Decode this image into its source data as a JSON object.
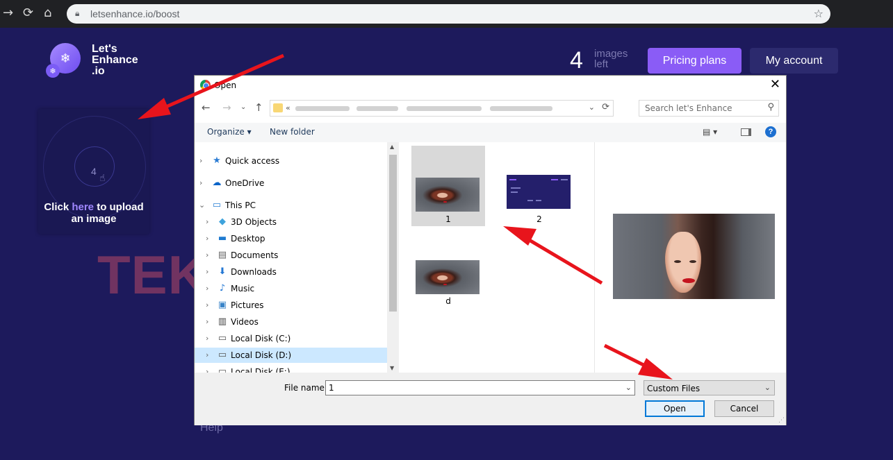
{
  "browser": {
    "url": "letsenhance.io/boost"
  },
  "app": {
    "logo": [
      "Let's",
      "Enhance",
      ".io"
    ],
    "credits_count": "4",
    "credits_label": [
      "images",
      "left"
    ],
    "pricing_button": "Pricing plans",
    "account_button": "My account",
    "upload": {
      "count": "4",
      "text_before": "Click ",
      "link": "here",
      "text_after": " to upload an image"
    },
    "help": "Help"
  },
  "watermark": "TEKNOSID.COM",
  "dialog": {
    "title": "Open",
    "address_prefix": "«",
    "search_placeholder": "Search let's Enhance",
    "organize": "Organize ▾",
    "new_folder": "New folder",
    "nav_items": [
      {
        "label": "Quick access",
        "icon": "star-icon"
      },
      {
        "label": "OneDrive",
        "icon": "cloud-icon"
      },
      {
        "label": "This PC",
        "icon": "computer-icon"
      },
      {
        "label": "3D Objects",
        "icon": "cube-icon"
      },
      {
        "label": "Desktop",
        "icon": "desktop-icon"
      },
      {
        "label": "Documents",
        "icon": "document-icon"
      },
      {
        "label": "Downloads",
        "icon": "download-icon"
      },
      {
        "label": "Music",
        "icon": "music-icon"
      },
      {
        "label": "Pictures",
        "icon": "picture-icon"
      },
      {
        "label": "Videos",
        "icon": "video-icon"
      },
      {
        "label": "Local Disk (C:)",
        "icon": "drive-icon"
      },
      {
        "label": "Local Disk (D:)",
        "icon": "drive-icon",
        "selected": true
      },
      {
        "label": "Local Disk (E:)",
        "icon": "drive-icon"
      }
    ],
    "files": [
      {
        "name": "1",
        "selected": true
      },
      {
        "name": "2"
      },
      {
        "name": "d"
      }
    ],
    "file_name_label": "File name:",
    "file_name_value": "1",
    "file_type": "Custom Files",
    "open_button": "Open",
    "cancel_button": "Cancel"
  },
  "colors": {
    "page_background": "#1d1a5c",
    "accent_purple": "#8a5cf6",
    "arrow_red": "#e8141c",
    "selection_blue": "#cce8ff"
  }
}
